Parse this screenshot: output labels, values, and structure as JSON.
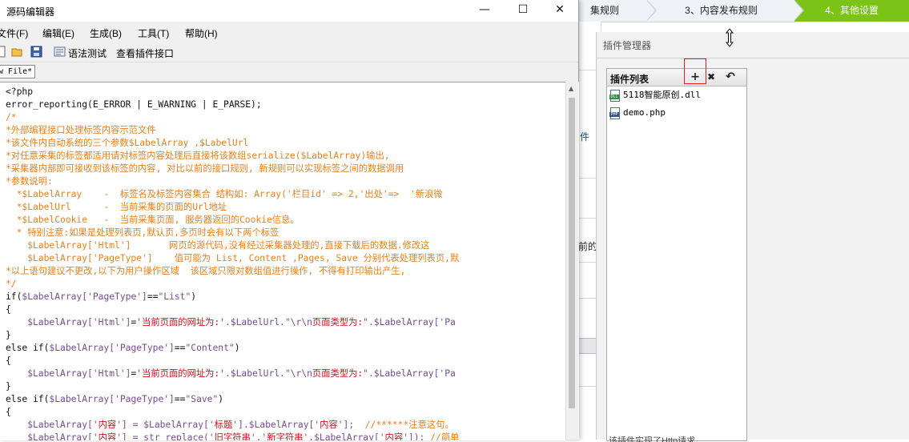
{
  "window": {
    "title": "源码编辑器",
    "controls": {
      "minimize": "—",
      "maximize": "☐",
      "close": "✕"
    }
  },
  "menu": [
    "文件(F)",
    "编辑(E)",
    "生成(B)",
    "工具(T)",
    "帮助(H)"
  ],
  "toolbar": {
    "syntax_test": "语法测试",
    "view_interface": "查看插件接口"
  },
  "file_tab": "w File*",
  "code_lines": [
    [
      {
        "t": "<?php",
        "c": "kw"
      }
    ],
    [
      {
        "t": "error_reporting(E_ERROR | E_WARNING | E_PARSE);",
        "c": "kw"
      }
    ],
    [
      {
        "t": "/*",
        "c": "cm"
      }
    ],
    [
      {
        "t": "*外部编程接口处理标签内容示范文件",
        "c": "cm"
      }
    ],
    [
      {
        "t": "*该文件内自动系统的三个参数$LabelArray ,$LabelUrl",
        "c": "cm"
      }
    ],
    [
      {
        "t": "*对任意采集的标签都适用请对标签内容处理后直接将该数组serialize($LabelArray)输出,",
        "c": "cm"
      }
    ],
    [
      {
        "t": "*采集器内部即可接收到该标签的内容, 对比以前的接口规则, 新规则可以实现标签之间的数据调用",
        "c": "cm"
      }
    ],
    [
      {
        "t": "*参数说明:",
        "c": "cm"
      }
    ],
    [
      {
        "t": "  *$LabelArray    -  标签名及标签内容集合 结构如: Array('栏目id' => 2,'出处'=>  '新浪微",
        "c": "cm"
      }
    ],
    [
      {
        "t": "  *$LabelUrl      -  当前采集的页面的Url地址",
        "c": "cm"
      }
    ],
    [
      {
        "t": "  *$LabelCookie   -  当前采集页面, 服务器返回的Cookie信息。",
        "c": "cm"
      }
    ],
    [
      {
        "t": "  * 特别注意:如果是处理列表页,默认页,多页时会有以下两个标签",
        "c": "cm"
      }
    ],
    [
      {
        "t": "    $LabelArray['Html']       网页的源代码,没有经过采集器处理的,直接下载后的数据.修改这",
        "c": "cm"
      }
    ],
    [
      {
        "t": "    $LabelArray['PageType']    值可能为 List, Content ,Pages, Save 分别代表处理列表页,默",
        "c": "cm"
      }
    ],
    [
      {
        "t": "*以上语句建议不更改,以下为用户操作区域  该区域只限对数组值进行操作, 不得有打印输出产生,",
        "c": "cm"
      }
    ],
    [
      {
        "t": "*/",
        "c": "cm"
      }
    ],
    [
      {
        "t": "if(",
        "c": "kw"
      },
      {
        "t": "$LabelArray",
        "c": "vr"
      },
      {
        "t": "['PageType']",
        "c": "vr"
      },
      {
        "t": "==",
        "c": "kw"
      },
      {
        "t": "\"List\"",
        "c": "vr"
      },
      {
        "t": ")",
        "c": "kw"
      }
    ],
    [
      {
        "t": "{",
        "c": "kw"
      }
    ],
    [
      {
        "t": "    $LabelArray['Html']",
        "c": "vr"
      },
      {
        "t": "=",
        "c": "kw"
      },
      {
        "t": "'当前页面的网址为:'",
        "c": "st"
      },
      {
        "t": ".$LabelUrl.",
        "c": "vr"
      },
      {
        "t": "\"\\r\\n",
        "c": "vr"
      },
      {
        "t": "页面类型为:",
        "c": "st"
      },
      {
        "t": "\".$LabelArray['Pa",
        "c": "vr"
      }
    ],
    [
      {
        "t": "}",
        "c": "kw"
      }
    ],
    [
      {
        "t": "else if(",
        "c": "kw"
      },
      {
        "t": "$LabelArray['PageType']",
        "c": "vr"
      },
      {
        "t": "==",
        "c": "kw"
      },
      {
        "t": "\"Content\"",
        "c": "vr"
      },
      {
        "t": ")",
        "c": "kw"
      }
    ],
    [
      {
        "t": "{",
        "c": "kw"
      }
    ],
    [
      {
        "t": "    $LabelArray['Html']",
        "c": "vr"
      },
      {
        "t": "=",
        "c": "kw"
      },
      {
        "t": "'当前页面的网址为:'",
        "c": "st"
      },
      {
        "t": ".$LabelUrl.",
        "c": "vr"
      },
      {
        "t": "\"\\r\\n",
        "c": "vr"
      },
      {
        "t": "页面类型为:",
        "c": "st"
      },
      {
        "t": "\".$LabelArray['Pa",
        "c": "vr"
      }
    ],
    [
      {
        "t": "}",
        "c": "kw"
      }
    ],
    [
      {
        "t": "else if(",
        "c": "kw"
      },
      {
        "t": "$LabelArray['PageType']",
        "c": "vr"
      },
      {
        "t": "==",
        "c": "kw"
      },
      {
        "t": "\"Save\"",
        "c": "vr"
      },
      {
        "t": ")",
        "c": "kw"
      }
    ],
    [
      {
        "t": "{",
        "c": "kw"
      }
    ],
    [
      {
        "t": "    $LabelArray['",
        "c": "vr"
      },
      {
        "t": "内容",
        "c": "st"
      },
      {
        "t": "'] = $LabelArray['",
        "c": "vr"
      },
      {
        "t": "标题",
        "c": "st"
      },
      {
        "t": "'].$LabelArray['",
        "c": "vr"
      },
      {
        "t": "内容",
        "c": "st"
      },
      {
        "t": "'];  ",
        "c": "vr"
      },
      {
        "t": "//******注意这句。",
        "c": "cm"
      }
    ],
    [
      {
        "t": "    $LabelArray['",
        "c": "vr"
      },
      {
        "t": "内容",
        "c": "st"
      },
      {
        "t": "'] = str_replace('",
        "c": "vr"
      },
      {
        "t": "旧字符串",
        "c": "st"
      },
      {
        "t": "','",
        "c": "vr"
      },
      {
        "t": "新字符串",
        "c": "st"
      },
      {
        "t": "',$LabelArray['",
        "c": "vr"
      },
      {
        "t": "内容",
        "c": "st"
      },
      {
        "t": "']); ",
        "c": "vr"
      },
      {
        "t": "//简单",
        "c": "cm"
      }
    ]
  ],
  "colors": {
    "kw": "#111111",
    "cm": "#e8801b",
    "vr": "#7a4a8e",
    "st": "#d4101c"
  },
  "steps": [
    "集规则",
    "3、内容发布规则",
    "4、其他设置"
  ],
  "behind_panel": {
    "item_a": "件",
    "item_b": "前的"
  },
  "plugin_manager": {
    "title": "插件管理器",
    "list_title": "插件列表",
    "tools": {
      "add": "+",
      "delete": "✖",
      "undo": "↶"
    },
    "items": [
      {
        "name": "5118智能原创.dll",
        "type": "DLL"
      },
      {
        "name": "demo.php",
        "type": "PHP"
      }
    ],
    "footer": "该插件实现了Http请求"
  }
}
